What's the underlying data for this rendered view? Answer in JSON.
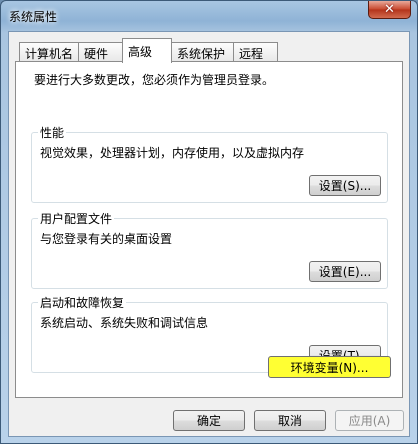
{
  "window": {
    "title": "系统属性"
  },
  "icons": {
    "close": "close-icon"
  },
  "tabs": [
    {
      "label": "计算机名",
      "active": false
    },
    {
      "label": "硬件",
      "active": false
    },
    {
      "label": "高级",
      "active": true
    },
    {
      "label": "系统保护",
      "active": false
    },
    {
      "label": "远程",
      "active": false
    }
  ],
  "advanced": {
    "admin_note": "要进行大多数更改，您必须作为管理员登录。",
    "performance": {
      "title": "性能",
      "description": "视觉效果，处理器计划，内存使用，以及虚拟内存",
      "button": "设置(S)..."
    },
    "user_profiles": {
      "title": "用户配置文件",
      "description": "与您登录有关的桌面设置",
      "button": "设置(E)..."
    },
    "startup_recovery": {
      "title": "启动和故障恢复",
      "description": "系统启动、系统失败和调试信息",
      "button": "设置(T)..."
    },
    "env_button": "环境变量(N)..."
  },
  "footer": {
    "ok": "确定",
    "cancel": "取消",
    "apply": "应用(A)"
  },
  "colors": {
    "highlight": "#ffff33"
  }
}
